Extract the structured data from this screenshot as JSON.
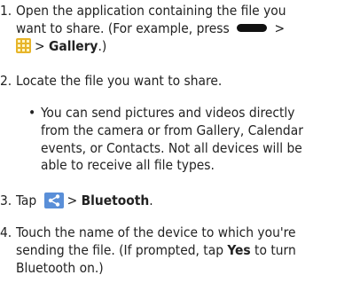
{
  "steps": [
    {
      "num": "1.",
      "line1": "Open the application containing the file you",
      "line2a": "want to share. (For example, press",
      "line2b": ">",
      "line3a": "> ",
      "line3b": "Gallery",
      "line3c": ".)"
    },
    {
      "num": "2.",
      "line1": "Locate the file you want to share."
    },
    {
      "bullet": "•",
      "lines": [
        "You can send pictures and videos directly",
        "from the camera or from Gallery, Calendar",
        "events, or Contacts. Not all devices will be",
        "able to receive all file types."
      ]
    },
    {
      "num": "3.",
      "pre": "Tap",
      "gt": "> ",
      "bold": "Bluetooth",
      "post": "."
    },
    {
      "num": "4.",
      "line1": "Touch the name of the device to which you're",
      "line2a": "sending the file. (If prompted, tap ",
      "line2b": "Yes",
      "line2c": " to turn",
      "line3": "Bluetooth on.)"
    }
  ],
  "icons": [
    "menu-key-icon",
    "apps-icon",
    "share-icon"
  ],
  "colors": {
    "text": "#222222",
    "apps": "#e7b52a",
    "share": "#5a8fd8"
  }
}
